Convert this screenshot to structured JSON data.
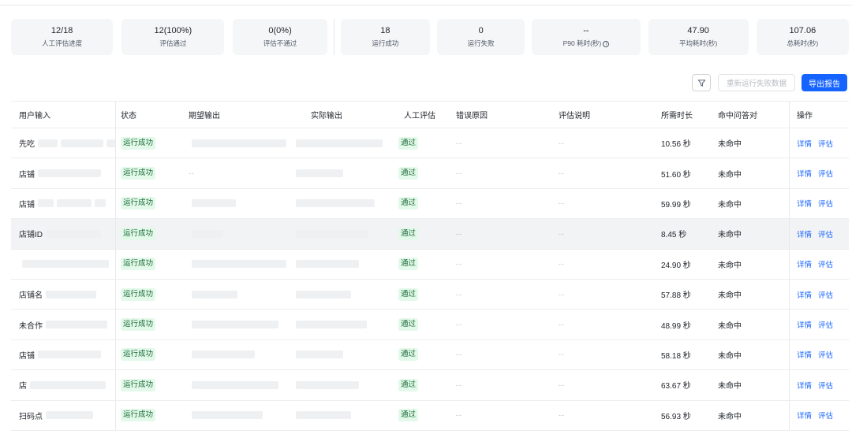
{
  "stats": [
    {
      "value": "12/18",
      "label": "人工评估进度"
    },
    {
      "value": "12(100%)",
      "label": "评估通过"
    },
    {
      "value": "0(0%)",
      "label": "评估不通过"
    },
    {
      "value": "18",
      "label": "运行成功"
    },
    {
      "value": "0",
      "label": "运行失败"
    },
    {
      "value": "--",
      "label": "P90 耗时(秒)",
      "icon": "info-icon"
    },
    {
      "value": "47.90",
      "label": "平均耗时(秒)"
    },
    {
      "value": "107.06",
      "label": "总耗时(秒)"
    }
  ],
  "toolbar": {
    "filter_icon": "filter-icon",
    "rerun_label": "重新运行失败数据",
    "export_label": "导出报告"
  },
  "table": {
    "headers": {
      "input": "用户输入",
      "status": "状态",
      "expected": "期望输出",
      "actual": "实际输出",
      "manual": "人工评估",
      "reason": "错误原因",
      "desc": "评估说明",
      "duration": "所需时长",
      "hit": "命中问答对",
      "ops": "操作"
    },
    "rows": [
      {
        "input": "先吃",
        "status": "运行成功",
        "expected": "",
        "actual": "",
        "manual": "通过",
        "reason": "--",
        "desc": "--",
        "duration": "10.56 秒",
        "hit": "未命中",
        "detail": "详情",
        "eval": "评估"
      },
      {
        "input": "店铺",
        "status": "运行成功",
        "expected": "--",
        "actual": "",
        "manual": "通过",
        "reason": "--",
        "desc": "--",
        "duration": "51.60 秒",
        "hit": "未命中",
        "detail": "详情",
        "eval": "评估"
      },
      {
        "input": "店铺",
        "status": "运行成功",
        "expected": "",
        "actual": "",
        "manual": "通过",
        "reason": "--",
        "desc": "--",
        "duration": "59.99 秒",
        "hit": "未命中",
        "detail": "详情",
        "eval": "评估"
      },
      {
        "input": "店铺ID",
        "status": "运行成功",
        "expected": "",
        "actual": "",
        "manual": "通过",
        "reason": "--",
        "desc": "--",
        "duration": "8.45 秒",
        "hit": "未命中",
        "detail": "详情",
        "eval": "评估"
      },
      {
        "input": "",
        "status": "运行成功",
        "expected": "",
        "actual": "",
        "manual": "通过",
        "reason": "--",
        "desc": "--",
        "duration": "24.90 秒",
        "hit": "未命中",
        "detail": "详情",
        "eval": "评估"
      },
      {
        "input": "店铺名",
        "status": "运行成功",
        "expected": "",
        "actual": "",
        "manual": "通过",
        "reason": "--",
        "desc": "--",
        "duration": "57.88 秒",
        "hit": "未命中",
        "detail": "详情",
        "eval": "评估"
      },
      {
        "input": "未合作",
        "status": "运行成功",
        "expected": "",
        "actual": "",
        "manual": "通过",
        "reason": "--",
        "desc": "--",
        "duration": "48.99 秒",
        "hit": "未命中",
        "detail": "详情",
        "eval": "评估"
      },
      {
        "input": "店铺",
        "status": "运行成功",
        "expected": "",
        "actual": "",
        "manual": "通过",
        "reason": "--",
        "desc": "--",
        "duration": "58.18 秒",
        "hit": "未命中",
        "detail": "详情",
        "eval": "评估"
      },
      {
        "input": "店",
        "status": "运行成功",
        "expected": "",
        "actual": "",
        "manual": "通过",
        "reason": "--",
        "desc": "--",
        "duration": "63.67 秒",
        "hit": "未命中",
        "detail": "详情",
        "eval": "评估"
      },
      {
        "input": "扫码点",
        "status": "运行成功",
        "expected": "",
        "actual": "",
        "manual": "通过",
        "reason": "--",
        "desc": "--",
        "duration": "56.93 秒",
        "hit": "未命中",
        "detail": "详情",
        "eval": "评估"
      }
    ]
  }
}
